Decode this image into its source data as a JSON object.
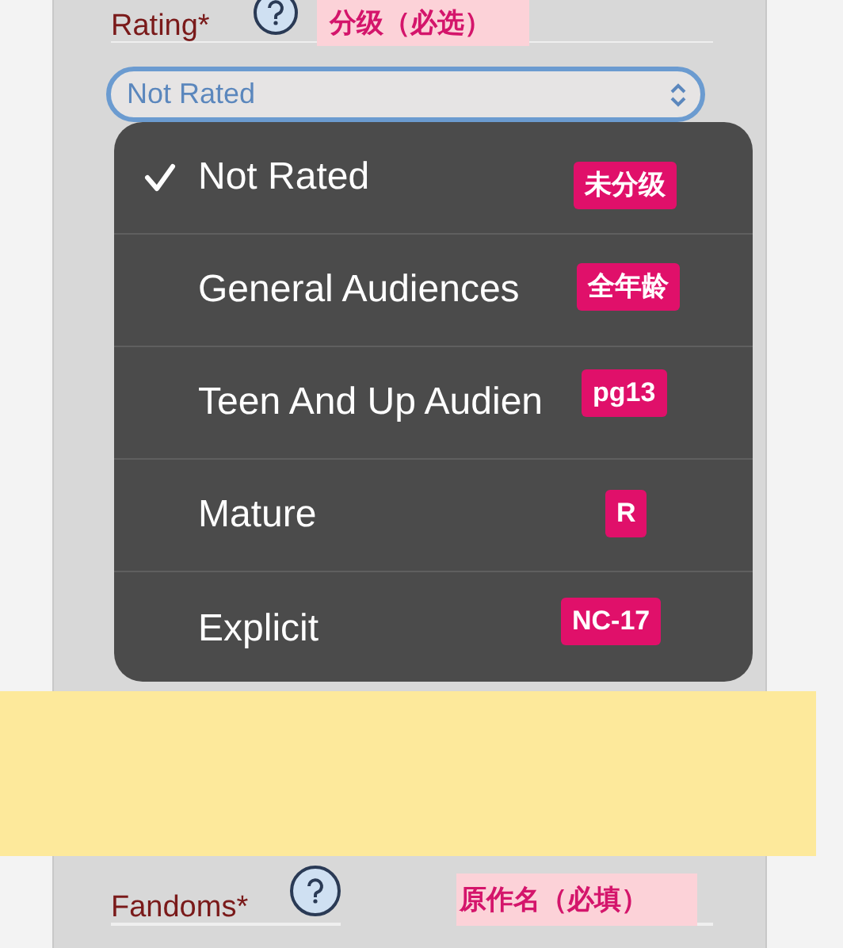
{
  "rating_field": {
    "label": "Rating*",
    "annotation": "分级（必选）",
    "value": "Not Rated"
  },
  "rating_menu": [
    {
      "label": "Not Rated",
      "selected": true,
      "annotation": "未分级"
    },
    {
      "label": "General Audiences",
      "selected": false,
      "annotation": "全年龄"
    },
    {
      "label": "Teen And Up Audien",
      "selected": false,
      "annotation": "pg13"
    },
    {
      "label": "Mature",
      "selected": false,
      "annotation": "R"
    },
    {
      "label": "Explicit",
      "selected": false,
      "annotation": "NC-17"
    }
  ],
  "fandoms_field": {
    "label": "Fandoms*",
    "annotation": "原作名（必填）"
  }
}
